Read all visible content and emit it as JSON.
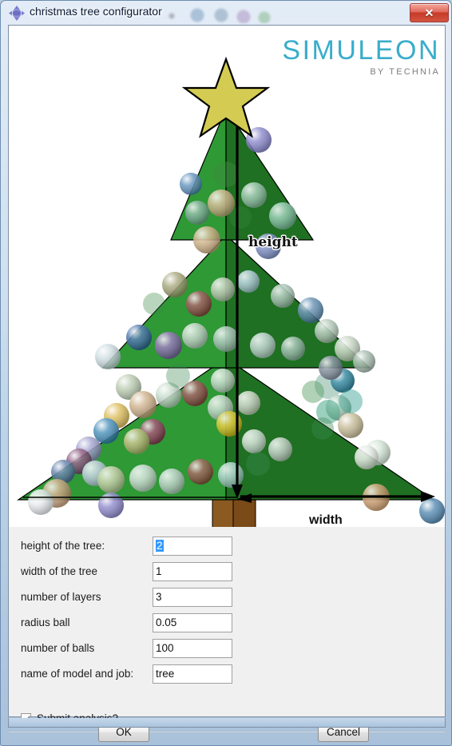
{
  "window": {
    "title": "christmas tree configurator",
    "icon": "simulia-diamond-icon",
    "close_label": "✕"
  },
  "logo": {
    "main": "SIMULEON",
    "sub": "BY TECHNIA",
    "color": "#38adcb",
    "sub_color": "#7d7d7d"
  },
  "canvas": {
    "height_label": "height",
    "width_label": "width",
    "star_color": "#d4cc52",
    "leaf_left_color": "#2e9935",
    "leaf_right_color": "#1f7022",
    "trunk_left_color": "#8b5a20",
    "trunk_right_color": "#7a4a18",
    "background": "#ffffff"
  },
  "form": {
    "fields": [
      {
        "label": "height of the tree:",
        "value": "2",
        "selected": true,
        "label_width": 165
      },
      {
        "label": "width of the tree",
        "value": "1",
        "selected": false,
        "label_width": 165
      },
      {
        "label": "number of layers",
        "value": "3",
        "selected": false,
        "label_width": 165
      },
      {
        "label": "radius ball",
        "value": "0.05",
        "selected": false,
        "label_width": 165
      },
      {
        "label": "number of balls",
        "value": "100",
        "selected": false,
        "label_width": 165
      },
      {
        "label": "name of model and job:",
        "value": "tree",
        "selected": false,
        "label_width": 165
      }
    ],
    "checkbox": {
      "label": "Submit analysis?",
      "checked": true
    }
  },
  "buttons": {
    "ok": "OK",
    "cancel": "Cancel"
  },
  "ornaments": {
    "count_visible": 100,
    "radius": "0.05"
  }
}
